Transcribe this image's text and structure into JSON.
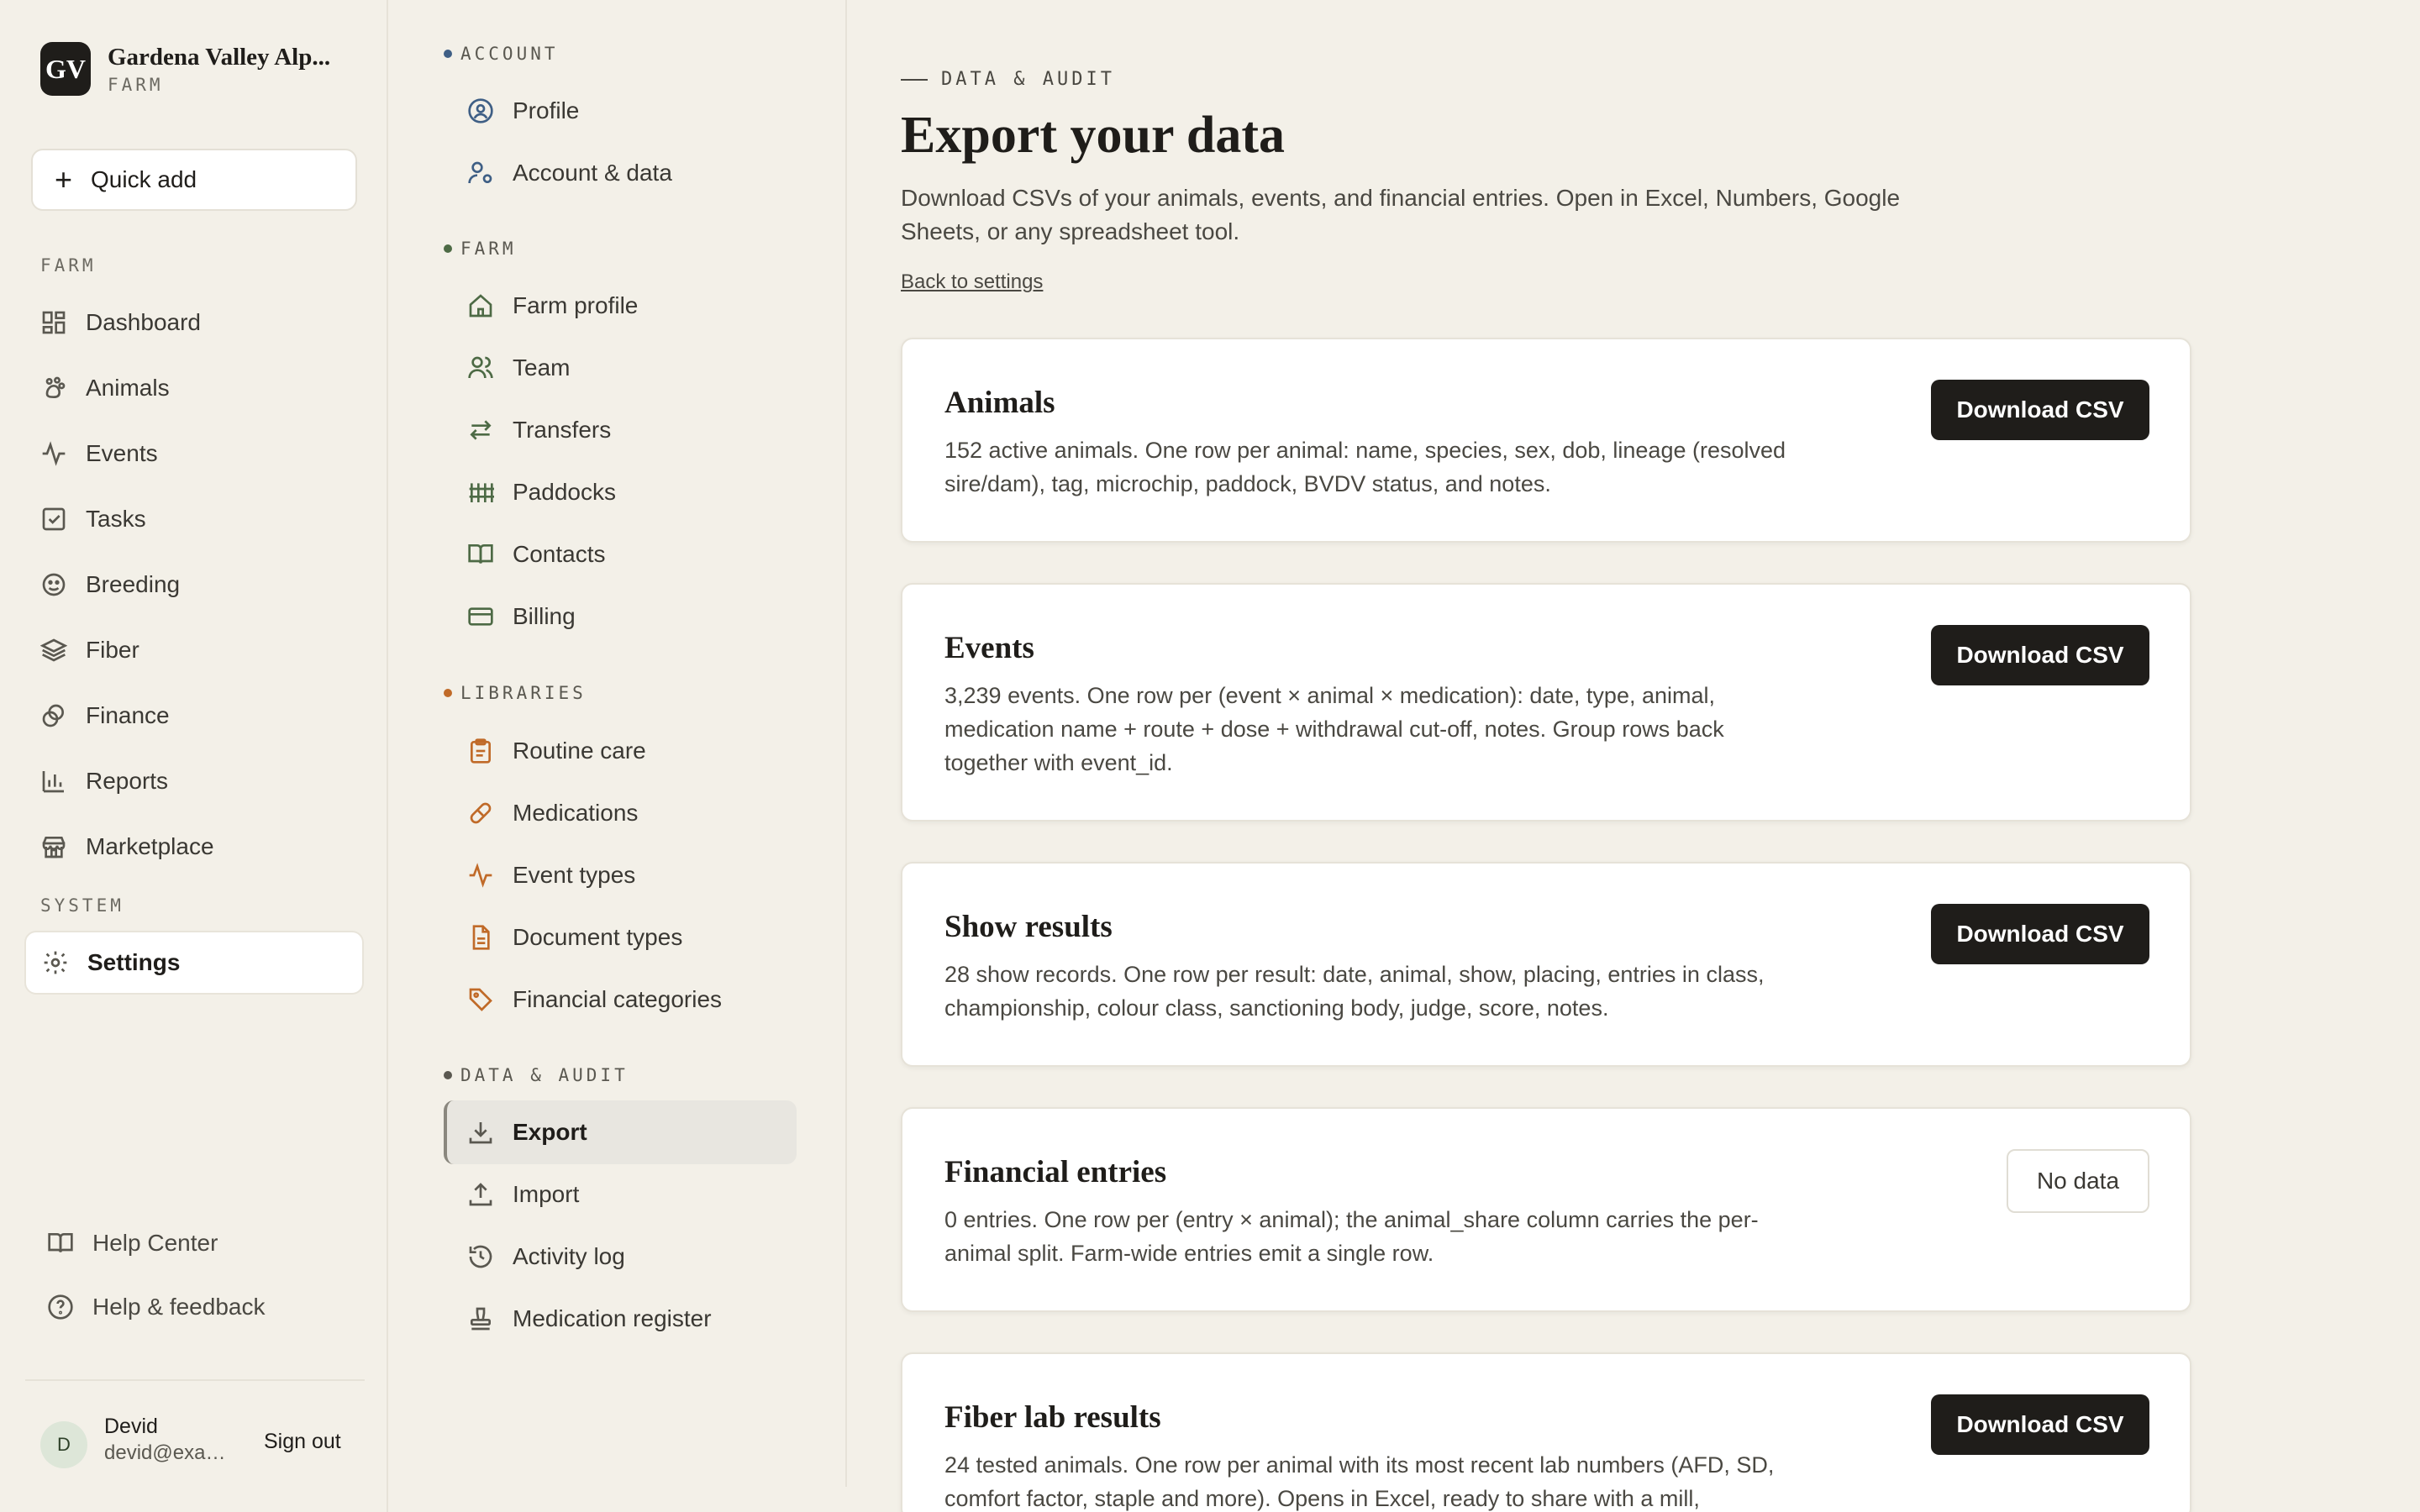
{
  "brand": {
    "initials": "GV",
    "name": "Gardena Valley Alp...",
    "sub": "FARM"
  },
  "quick_add": {
    "icon": "plus-icon",
    "label": "Quick add"
  },
  "sidebar": {
    "section_farm": "FARM",
    "items": [
      {
        "label": "Dashboard",
        "icon": "dashboard-icon"
      },
      {
        "label": "Animals",
        "icon": "paw-icon"
      },
      {
        "label": "Events",
        "icon": "activity-icon"
      },
      {
        "label": "Tasks",
        "icon": "checkbox-icon"
      },
      {
        "label": "Breeding",
        "icon": "breeding-icon"
      },
      {
        "label": "Fiber",
        "icon": "layers-icon"
      },
      {
        "label": "Finance",
        "icon": "coins-icon"
      },
      {
        "label": "Reports",
        "icon": "bar-chart-icon"
      },
      {
        "label": "Marketplace",
        "icon": "store-icon"
      }
    ],
    "section_system": "SYSTEM",
    "settings": {
      "label": "Settings",
      "icon": "gear-icon"
    },
    "help_center": "Help Center",
    "help_feedback": "Help & feedback"
  },
  "user": {
    "initial": "D",
    "name": "Devid",
    "email": "devid@example.com",
    "sign_out": "Sign out"
  },
  "subnav": {
    "account": {
      "label": "ACCOUNT",
      "items": [
        "Profile",
        "Account & data"
      ]
    },
    "farm": {
      "label": "FARM",
      "items": [
        "Farm profile",
        "Team",
        "Transfers",
        "Paddocks",
        "Contacts",
        "Billing"
      ]
    },
    "libraries": {
      "label": "LIBRARIES",
      "items": [
        "Routine care",
        "Medications",
        "Event types",
        "Document types",
        "Financial categories"
      ]
    },
    "data_audit": {
      "label": "DATA & AUDIT",
      "items": [
        "Export",
        "Import",
        "Activity log",
        "Medication register"
      ]
    }
  },
  "main": {
    "eyebrow": "DATA & AUDIT",
    "title": "Export your data",
    "description": "Download CSVs of your animals, events, and financial entries. Open in Excel, Numbers, Google Sheets, or any spreadsheet tool.",
    "back_link": "Back to settings",
    "cards": [
      {
        "title": "Animals",
        "desc": "152 active animals. One row per animal: name, species, sex, dob, lineage (resolved sire/dam), tag, microchip, paddock, BVDV status, and notes.",
        "button": "Download CSV"
      },
      {
        "title": "Events",
        "desc": "3,239 events. One row per (event × animal × medication): date, type, animal, medication name + route + dose + withdrawal cut-off, notes. Group rows back together with event_id.",
        "button": "Download CSV"
      },
      {
        "title": "Show results",
        "desc": "28 show records. One row per result: date, animal, show, placing, entries in class, championship, colour class, sanctioning body, judge, score, notes.",
        "button": "Download CSV"
      },
      {
        "title": "Financial entries",
        "desc": "0 entries. One row per (entry × animal); the animal_share column carries the per-animal split. Farm-wide entries emit a single row.",
        "button": "No data"
      },
      {
        "title": "Fiber lab results",
        "desc": "24 tested animals. One row per animal with its most recent lab numbers (AFD, SD, comfort factor, staple and more). Opens in Excel, ready to share with a mill,",
        "button": "Download CSV"
      }
    ]
  },
  "colors": {
    "background": "#f3f0e8",
    "primary_button": "#1f1d1a",
    "account_dot": "#3f5f85",
    "farm_dot": "#4d6a45",
    "libraries_dot": "#c06a28",
    "data_audit_dot": "#5a5850"
  }
}
